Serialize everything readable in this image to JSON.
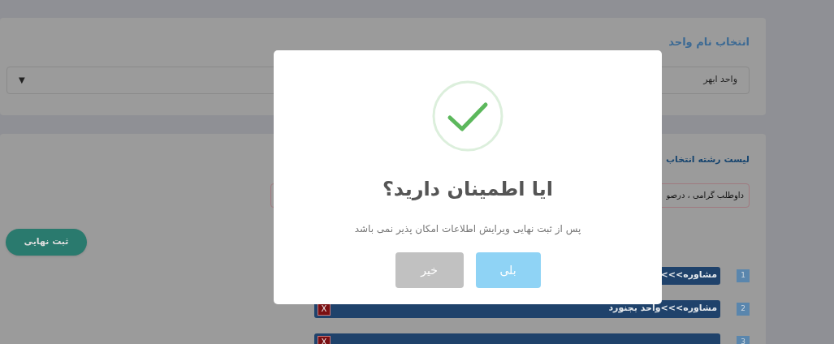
{
  "unit_panel": {
    "title": "انتخاب نام واحد",
    "dropdown": {
      "value": "واحد ابهر",
      "arrow": "▼"
    }
  },
  "choices_panel": {
    "title": "لیست رشته انتخاب",
    "notice": "داوطلب گرامی ، درصو",
    "submit_button": "ثبت نهایی",
    "rows": [
      {
        "number": "1",
        "label": "مشاوره>>>",
        "remove_button": false
      },
      {
        "number": "2",
        "label": "مشاوره>>>واحد بجنورد",
        "remove_button": true,
        "remove_label": "X"
      },
      {
        "number": "3",
        "remove_button": true,
        "remove_label": "X"
      }
    ]
  },
  "dialog": {
    "title": "ایا اطمینان دارید؟",
    "message": "پس از ثبت نهایی ویرایش اطلاعات امکان پذیر نمی باشد",
    "buttons": [
      {
        "label": "بلی",
        "kind": "confirm"
      },
      {
        "label": "خیر",
        "kind": "cancel"
      }
    ]
  }
}
